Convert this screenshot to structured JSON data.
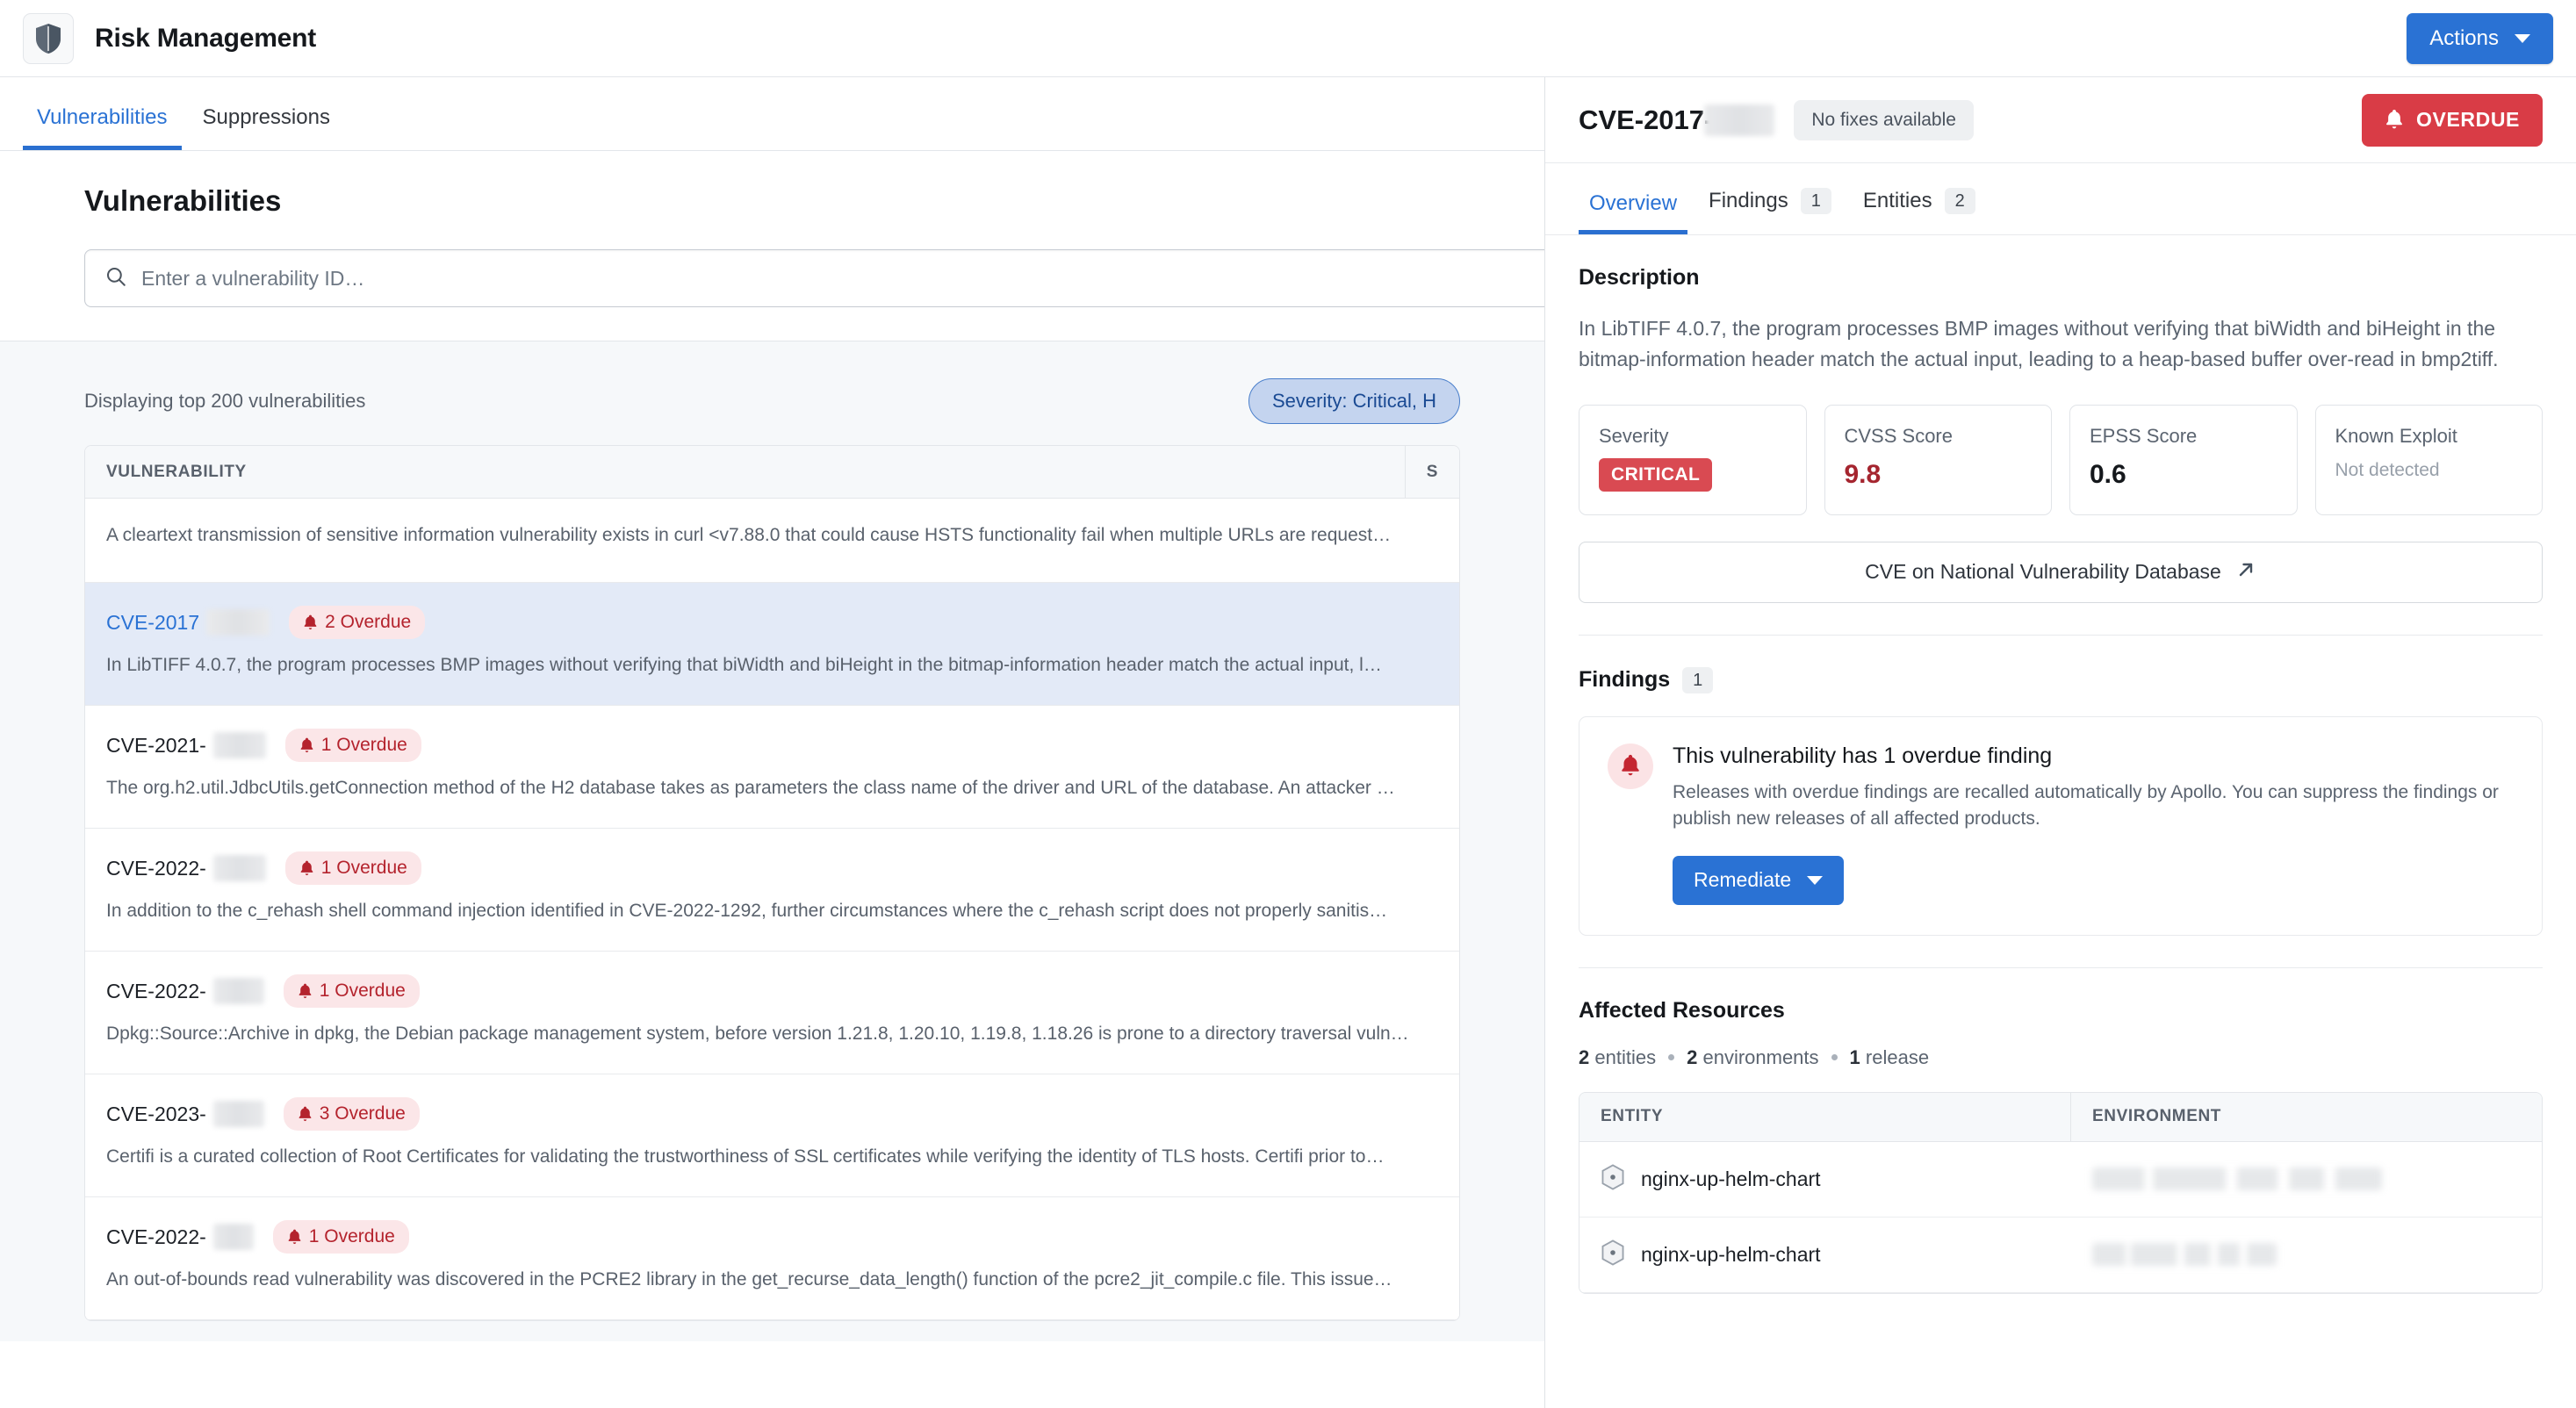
{
  "app": {
    "title": "Risk Management",
    "icon": "shield-icon",
    "actions_label": "Actions"
  },
  "page_tabs": [
    {
      "label": "Vulnerabilities",
      "active": true
    },
    {
      "label": "Suppressions",
      "active": false
    }
  ],
  "main": {
    "title": "Vulnerabilities",
    "search_placeholder": "Enter a vulnerability ID…",
    "search_value": "",
    "search_icon": "search-icon",
    "list_meta": "Displaying top 200 vulnerabilities",
    "filter_pill": "Severity: Critical, H",
    "columns": {
      "vulnerability": "VULNERABILITY",
      "severity": "S"
    },
    "rows": [
      {
        "id": "",
        "id_redacted": true,
        "overdue": "",
        "overdue_hidden": true,
        "description": "A cleartext transmission of sensitive information vulnerability exists in curl <v7.88.0 that could cause HSTS functionality fail when multiple URLs are request…",
        "selected": false,
        "partial": true,
        "severity_color": "#c33a42"
      },
      {
        "id": "CVE-2017",
        "id_redacted": true,
        "overdue": "2 Overdue",
        "description": "In LibTIFF 4.0.7, the program processes BMP images without verifying that biWidth and biHeight in the bitmap-information header match the actual input, l…",
        "selected": true,
        "partial": false,
        "severity_color": "#c33a42"
      },
      {
        "id": "CVE-2021-",
        "id_redacted": true,
        "overdue": "1 Overdue",
        "description": "The org.h2.util.JdbcUtils.getConnection method of the H2 database takes as parameters the class name of the driver and URL of the database. An attacker …",
        "selected": false,
        "partial": false,
        "severity_color": "#c33a42"
      },
      {
        "id": "CVE-2022-",
        "id_redacted": true,
        "overdue": "1 Overdue",
        "description": "In addition to the c_rehash shell command injection identified in CVE-2022-1292, further circumstances where the c_rehash script does not properly sanitis…",
        "selected": false,
        "partial": false,
        "severity_color": "#c33a42"
      },
      {
        "id": "CVE-2022-",
        "id_redacted": true,
        "overdue": "1 Overdue",
        "description": "Dpkg::Source::Archive in dpkg, the Debian package management system, before version 1.21.8, 1.20.10, 1.19.8, 1.18.26 is prone to a directory traversal vuln…",
        "selected": false,
        "partial": false,
        "severity_color": "#c33a42"
      },
      {
        "id": "CVE-2023-",
        "id_redacted": true,
        "overdue": "3 Overdue",
        "description": "Certifi is a curated collection of Root Certificates for validating the trustworthiness of SSL certificates while verifying the identity of TLS hosts. Certifi prior to…",
        "selected": false,
        "partial": false,
        "severity_color": "#c33a42"
      },
      {
        "id": "CVE-2022-",
        "id_redacted": true,
        "overdue": "1 Overdue",
        "description": "An out-of-bounds read vulnerability was discovered in the PCRE2 library in the get_recurse_data_length() function of the pcre2_jit_compile.c file. This issue…",
        "selected": false,
        "partial": false,
        "severity_color": "#c33a42"
      }
    ]
  },
  "detail": {
    "cve_id": "CVE-2017-",
    "no_fixes_label": "No fixes available",
    "overdue_button": "OVERDUE",
    "bell_icon": "bell-icon",
    "tabs": [
      {
        "label": "Overview",
        "count": "",
        "active": true
      },
      {
        "label": "Findings",
        "count": "1",
        "active": false
      },
      {
        "label": "Entities",
        "count": "2",
        "active": false
      }
    ],
    "description_heading": "Description",
    "description": "In LibTIFF 4.0.7, the program processes BMP images without verifying that biWidth and biHeight in the bitmap-information header match the actual input, leading to a heap-based buffer over-read in bmp2tiff.",
    "metrics": [
      {
        "label": "Severity",
        "badge": "CRITICAL",
        "value": "",
        "sub": ""
      },
      {
        "label": "CVSS Score",
        "badge": "",
        "value": "9.8",
        "sub": ""
      },
      {
        "label": "EPSS Score",
        "badge": "",
        "value": "0.6",
        "sub": ""
      },
      {
        "label": "Known Exploit",
        "badge": "",
        "value": "",
        "sub": "Not detected"
      }
    ],
    "nvd_button": "CVE on National Vulnerability Database",
    "external_link_icon": "external-link-icon",
    "findings_heading": "Findings",
    "findings_count": "1",
    "alert": {
      "title": "This vulnerability has 1 overdue finding",
      "body": "Releases with overdue findings are recalled automatically by Apollo. You can suppress the findings or publish new releases of all affected products.",
      "button": "Remediate"
    },
    "resources_heading": "Affected Resources",
    "resource_counts": {
      "entities_num": "2",
      "entities_label": "entities",
      "environments_num": "2",
      "environments_label": "environments",
      "releases_num": "1",
      "releases_label": "release"
    },
    "resource_columns": {
      "entity": "ENTITY",
      "environment": "ENVIRONMENT"
    },
    "resource_rows": [
      {
        "entity": "nginx-up-helm-chart",
        "entity_icon": "hexagon-node-icon",
        "environment_redacted": true
      },
      {
        "entity": "nginx-up-helm-chart",
        "entity_icon": "hexagon-node-icon",
        "environment_redacted": true
      }
    ]
  },
  "colors": {
    "accent": "#2a72d4",
    "critical": "#d94a52",
    "overdue": "#d93c46",
    "severity_bar": "#c33a42",
    "selected_row": "#e3eaf7"
  }
}
